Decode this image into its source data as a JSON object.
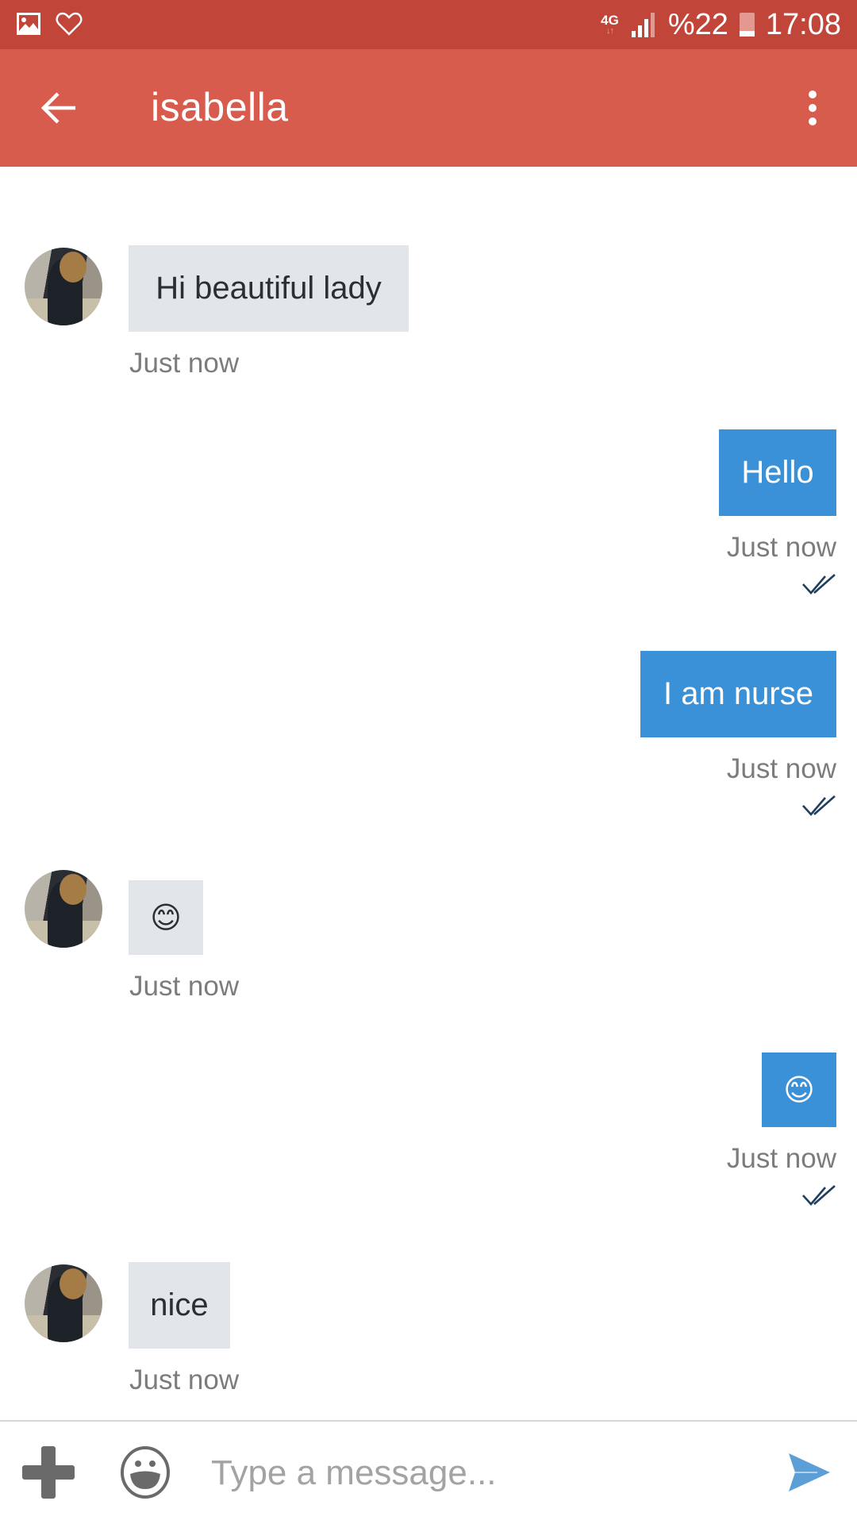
{
  "status_bar": {
    "left_icons": [
      "gallery-icon",
      "heart-icon"
    ],
    "network": "4G",
    "signal_icon": "signal-icon",
    "battery_text": "%22",
    "battery_level_percent": 22,
    "time": "17:08"
  },
  "header": {
    "back_icon": "arrow-left-icon",
    "title": "isabella",
    "menu_icon": "more-vert-icon"
  },
  "messages": [
    {
      "direction": "incoming",
      "text": "Hi beautiful lady",
      "time": "Just now"
    },
    {
      "direction": "outgoing",
      "text": "Hello",
      "time": "Just now",
      "status": "read"
    },
    {
      "direction": "outgoing",
      "text": "I am nurse",
      "time": "Just now",
      "status": "read"
    },
    {
      "direction": "incoming",
      "text": "😊",
      "time": "Just now"
    },
    {
      "direction": "outgoing",
      "text": "😊",
      "time": "Just now",
      "status": "read"
    },
    {
      "direction": "incoming",
      "text": "nice",
      "time": "Just now"
    }
  ],
  "composer": {
    "attach_icon": "plus-icon",
    "emoji_icon": "emoji-icon",
    "placeholder": "Type a message...",
    "value": "",
    "send_icon": "send-icon"
  },
  "colors": {
    "status_bar": "#c2453a",
    "app_bar": "#d85c4d",
    "outgoing_bubble": "#3b91d8",
    "incoming_bubble": "#e2e6eb",
    "send_icon": "#5c9fd6",
    "read_check": "#1f3f5f"
  }
}
